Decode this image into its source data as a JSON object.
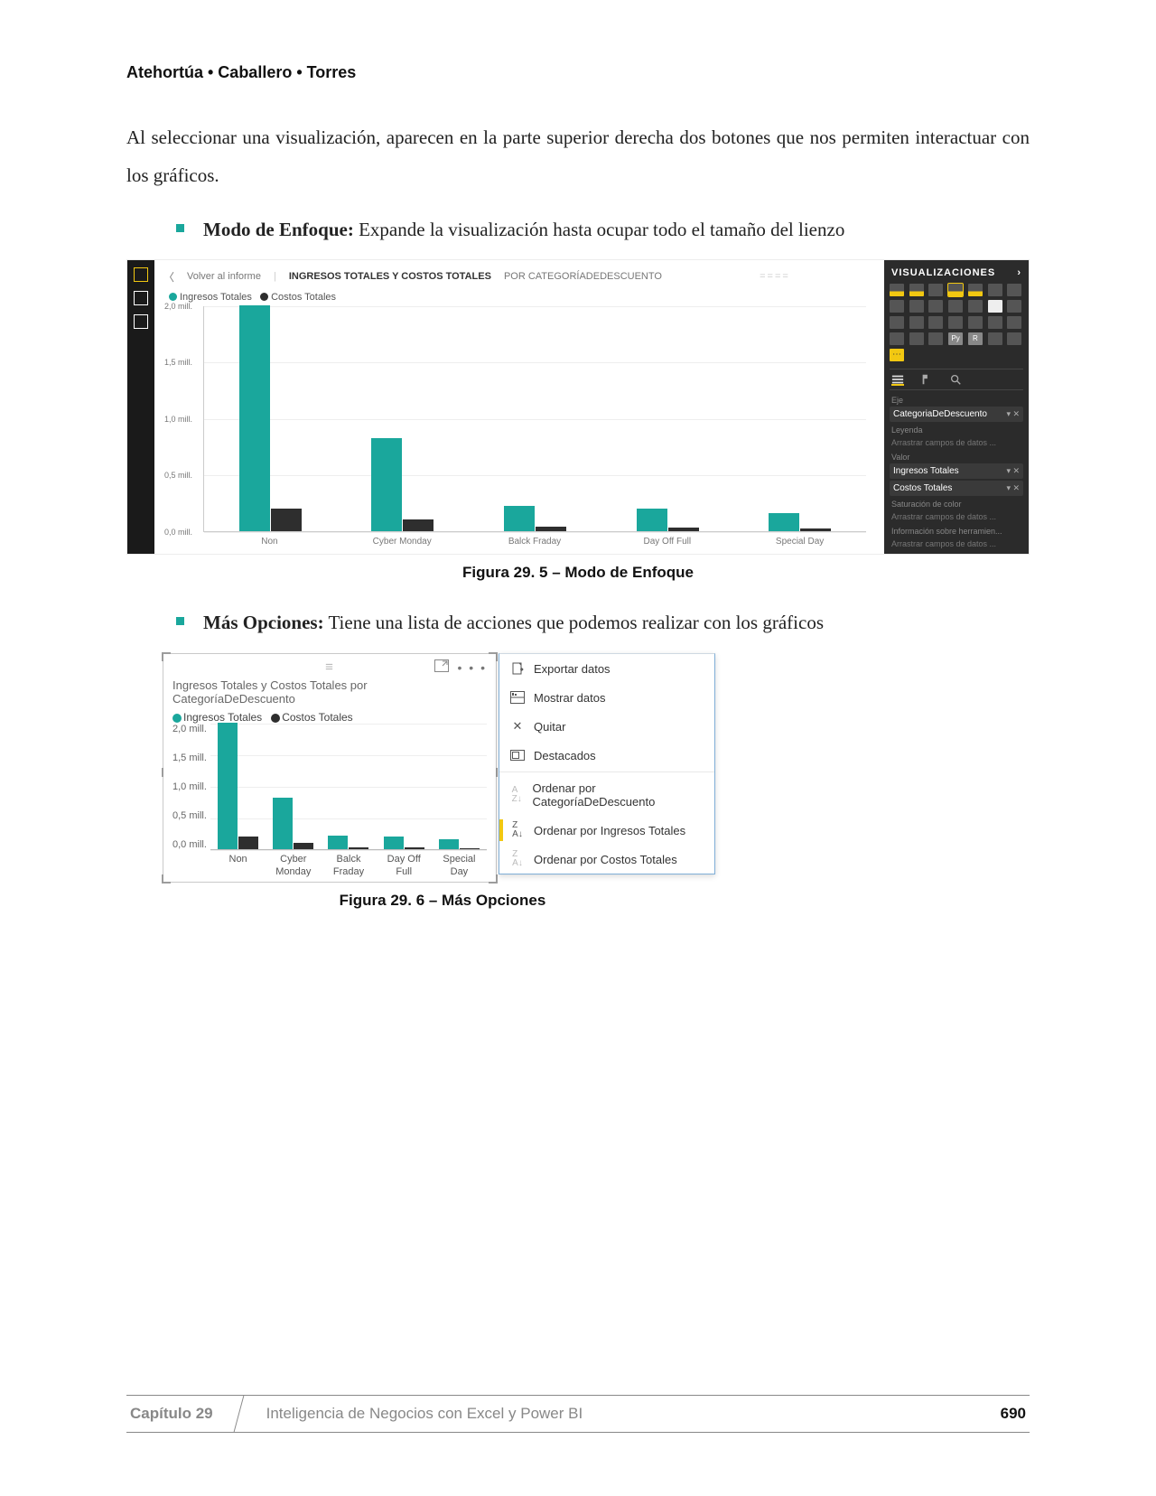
{
  "header": {
    "authors": "Atehortúa • Caballero • Torres"
  },
  "para1": "Al seleccionar una visualización, aparecen en la parte superior derecha dos botones que nos permiten interactuar con los gráficos.",
  "bullet1": {
    "label": "Modo de Enfoque:",
    "text": " Expande la visualización hasta ocupar todo el tamaño del lienzo"
  },
  "bullet2": {
    "label": "Más Opciones:",
    "text": " Tiene una lista de acciones que podemos realizar con los gráficos"
  },
  "fig1": {
    "caption": "Figura 29. 5 – Modo de Enfoque",
    "back": "Volver al informe",
    "title_strong": "INGRESOS TOTALES Y COSTOS TOTALES",
    "title_light": "POR CATEGORÍADEDESCUENTO",
    "legend": {
      "a": "Ingresos Totales",
      "b": "Costos Totales"
    },
    "panel": {
      "header": "VISUALIZACIONES",
      "axis_label": "Eje",
      "axis_field": "CategoriaDeDescuento",
      "legend_label": "Leyenda",
      "legend_placeholder": "Arrastrar campos de datos ...",
      "value_label": "Valor",
      "value_fields": [
        "Ingresos Totales",
        "Costos Totales"
      ],
      "sat_label": "Saturación de color",
      "sat_placeholder": "Arrastrar campos de datos ...",
      "info_label": "Información sobre herramien...",
      "info_placeholder": "Arrastrar campos de datos ..."
    }
  },
  "fig2": {
    "caption": "Figura 29. 6 – Más Opciones",
    "chart_title": "Ingresos Totales y Costos Totales por CategoríaDeDescuento",
    "legend": {
      "a": "Ingresos Totales",
      "b": "Costos Totales"
    },
    "menu": {
      "export": "Exportar datos",
      "show": "Mostrar datos",
      "remove": "Quitar",
      "spotlight": "Destacados",
      "sort_cat": "Ordenar por CategoríaDeDescuento",
      "sort_ing": "Ordenar por Ingresos Totales",
      "sort_cos": "Ordenar por Costos Totales"
    }
  },
  "chart_data": [
    {
      "id": "fig_29_5",
      "type": "bar",
      "title": "Ingresos Totales y Costos Totales por CategoríaDeDescuento",
      "ylabel": "mill.",
      "ylim": [
        0,
        2.0
      ],
      "yticks": [
        "2,0 mill.",
        "1,5 mill.",
        "1,0 mill.",
        "0,5 mill.",
        "0,0 mill."
      ],
      "categories": [
        "Non",
        "Cyber Monday",
        "Balck Fraday",
        "Day Off Full",
        "Special Day"
      ],
      "series": [
        {
          "name": "Ingresos Totales",
          "values": [
            2.0,
            0.82,
            0.22,
            0.2,
            0.16
          ]
        },
        {
          "name": "Costos Totales",
          "values": [
            0.2,
            0.1,
            0.04,
            0.03,
            0.02
          ]
        }
      ]
    },
    {
      "id": "fig_29_6",
      "type": "bar",
      "title": "Ingresos Totales y Costos Totales por CategoríaDeDescuento",
      "ylim": [
        0,
        2.0
      ],
      "yticks": [
        "2,0 mill.",
        "1,5 mill.",
        "1,0 mill.",
        "0,5 mill.",
        "0,0 mill."
      ],
      "categories": [
        "Non",
        "Cyber Monday",
        "Balck Fraday",
        "Day Off Full",
        "Special Day"
      ],
      "categories_wrapped": [
        [
          "Non"
        ],
        [
          "Cyber",
          "Monday"
        ],
        [
          "Balck",
          "Fraday"
        ],
        [
          "Day Off",
          "Full"
        ],
        [
          "Special",
          "Day"
        ]
      ],
      "series": [
        {
          "name": "Ingresos Totales",
          "values": [
            2.0,
            0.82,
            0.22,
            0.2,
            0.16
          ]
        },
        {
          "name": "Costos Totales",
          "values": [
            0.2,
            0.1,
            0.04,
            0.03,
            0.02
          ]
        }
      ]
    }
  ],
  "footer": {
    "chapter": "Capítulo 29",
    "title": "Inteligencia de Negocios con Excel y Power BI",
    "page": "690"
  }
}
